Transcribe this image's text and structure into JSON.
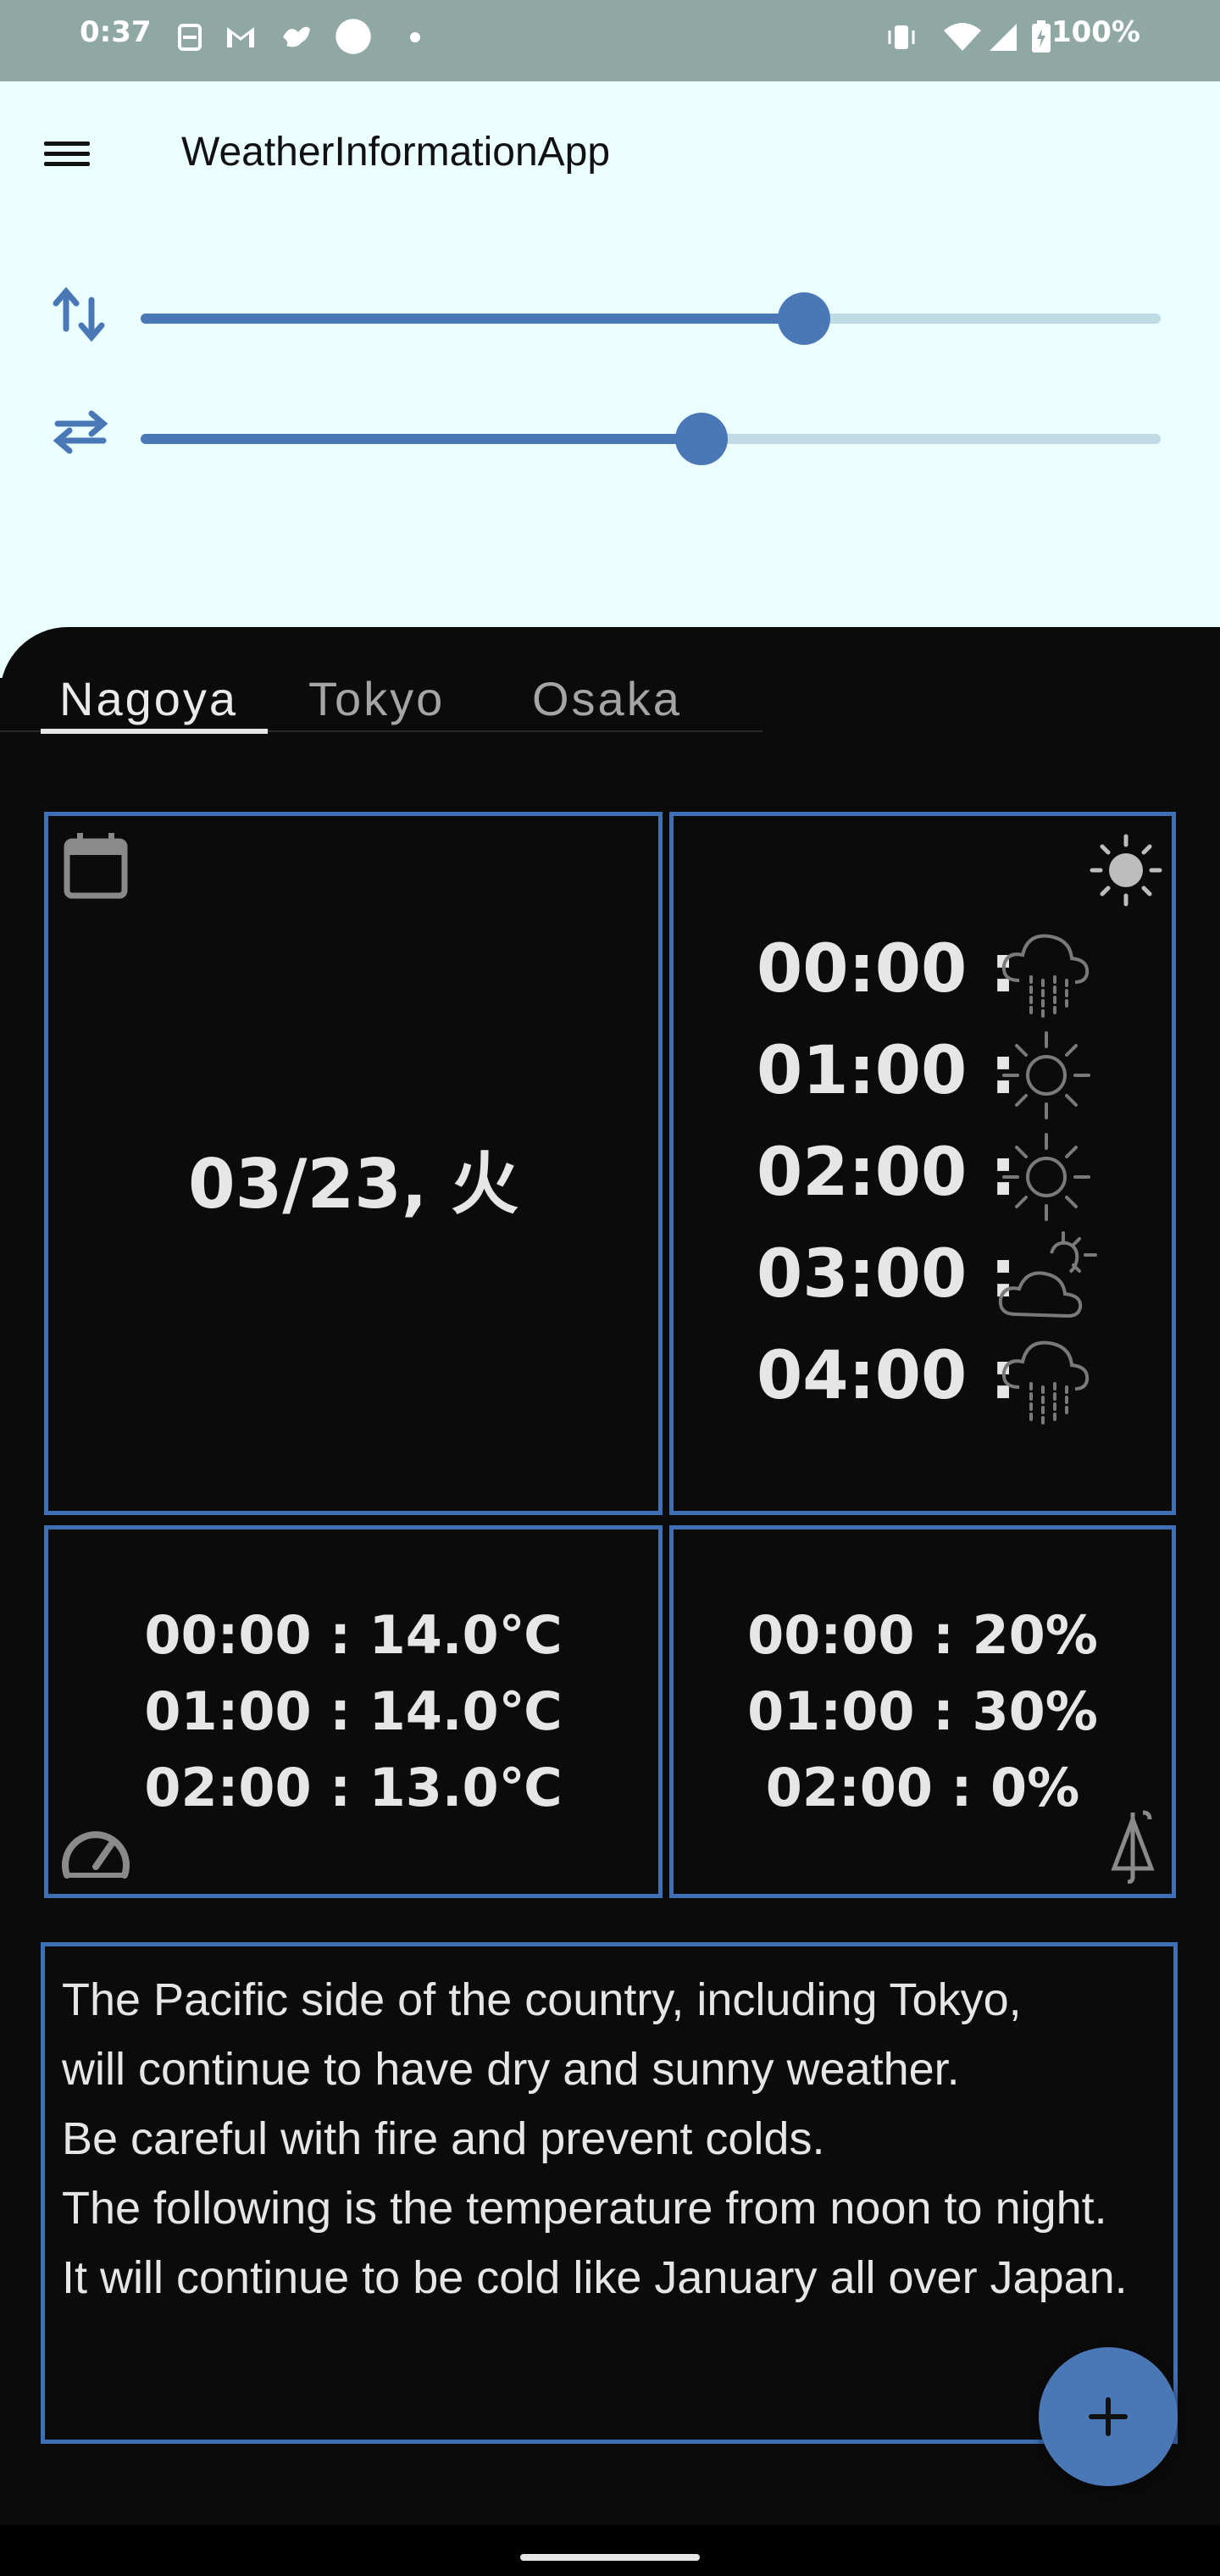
{
  "status_bar": {
    "time": "0:37",
    "battery": "100%"
  },
  "app_bar": {
    "title": "WeatherInformationApp"
  },
  "sliders": [
    {
      "name": "vertical",
      "value": 0.65
    },
    {
      "name": "horizontal",
      "value": 0.55
    }
  ],
  "tabs": [
    {
      "label": "Nagoya",
      "selected": true
    },
    {
      "label": "Tokyo",
      "selected": false
    },
    {
      "label": "Osaka",
      "selected": false
    }
  ],
  "date_card": {
    "date": "03/23, 火"
  },
  "hourly_weather": [
    {
      "time": "00:00 :",
      "icon": "rain-cloud-icon"
    },
    {
      "time": "01:00 :",
      "icon": "sun-icon"
    },
    {
      "time": "02:00 :",
      "icon": "sun-icon"
    },
    {
      "time": "03:00 :",
      "icon": "partly-cloudy-icon"
    },
    {
      "time": "04:00 :",
      "icon": "rain-cloud-icon"
    }
  ],
  "temperature": [
    "00:00 : 14.0℃",
    "01:00 : 14.0℃",
    "02:00 : 13.0℃"
  ],
  "precipitation": [
    "00:00 : 20%",
    "01:00 : 30%",
    "02:00 : 0%"
  ],
  "forecast": {
    "text": "The Pacific side of the country, including Tokyo,\nwill continue to have dry and sunny weather.\nBe careful with fire and prevent colds.\nThe following is the temperature from noon to night.\nIt will continue to be cold like January all over Japan."
  },
  "colors": {
    "accent": "#4a78b7",
    "top_background": "#eafffe",
    "status_bar": "#8fa8a3",
    "dark_background": "#0b0b0c"
  }
}
